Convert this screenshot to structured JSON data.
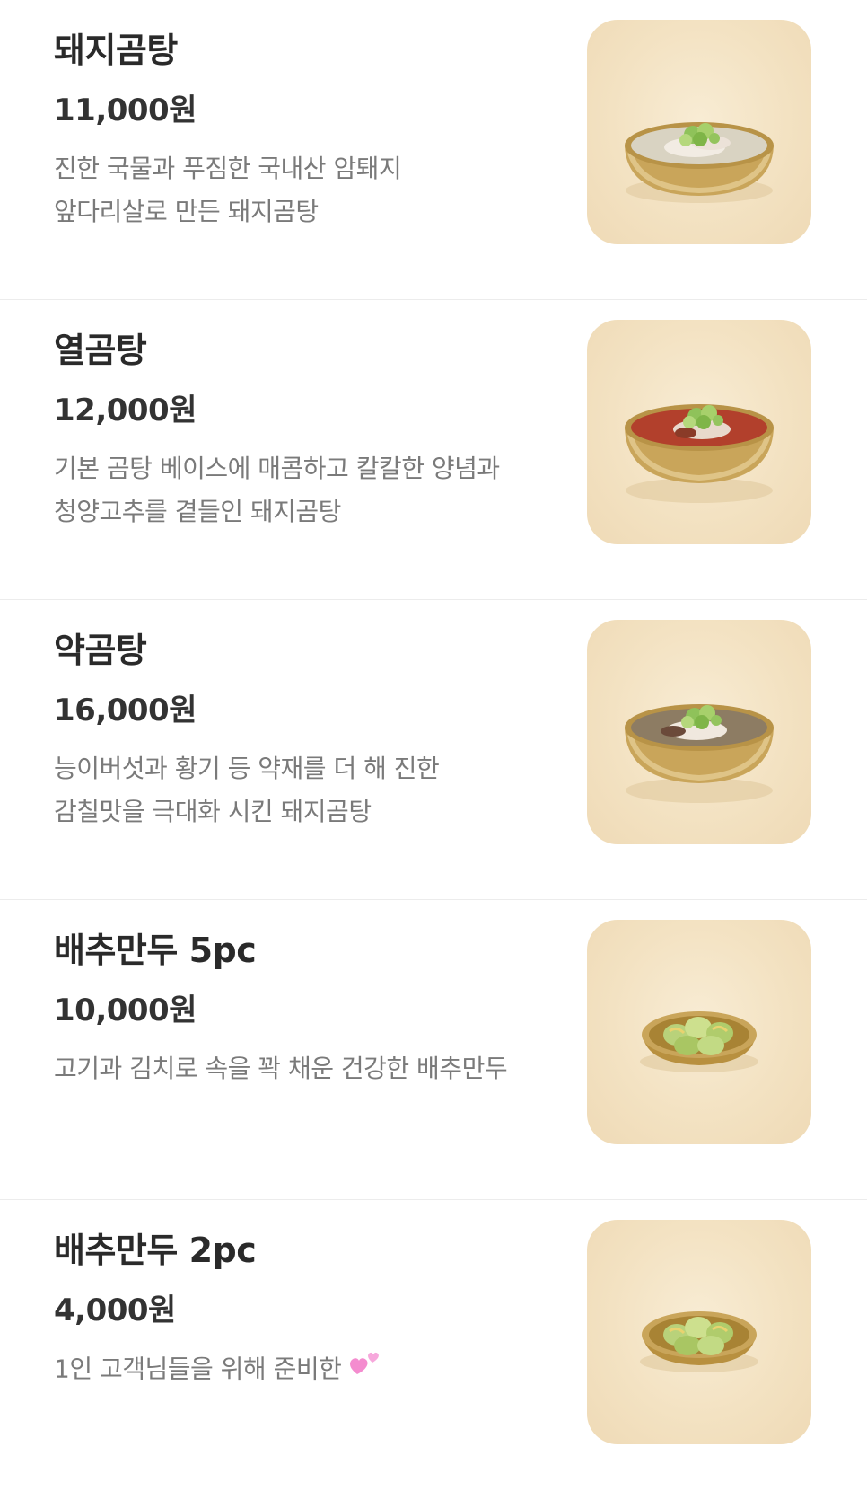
{
  "menu": {
    "items": [
      {
        "name": "돼지곰탕",
        "price": "11,000원",
        "description": "진한 국물과 푸짐한 국내산 암퇘지\n앞다리살로 만든 돼지곰탕",
        "photo": "clear-broth-bowl"
      },
      {
        "name": "열곰탕",
        "price": "12,000원",
        "description": "기본 곰탕 베이스에 매콤하고 칼칼한 양념과\n청양고추를 곁들인 돼지곰탕",
        "photo": "red-broth-bowl"
      },
      {
        "name": "약곰탕",
        "price": "16,000원",
        "description": "능이버섯과 황기 등 약재를 더 해 진한\n감칠맛을 극대화 시킨 돼지곰탕",
        "photo": "dark-broth-bowl"
      },
      {
        "name": "배추만두 5pc",
        "price": "10,000원",
        "description": "고기과 김치로 속을 꽉 채운 건강한 배추만두",
        "photo": "dumpling-plate"
      },
      {
        "name": "배추만두 2pc",
        "price": "4,000원",
        "description": "1인 고객님들을 위해 준비한",
        "photo": "dumpling-plate",
        "emoji": "two-hearts-icon"
      }
    ]
  },
  "colors": {
    "photo_background": "#f3e2c2",
    "brass": "#c9a55a",
    "divider": "#ececec",
    "description_text": "#7a7a7a"
  }
}
